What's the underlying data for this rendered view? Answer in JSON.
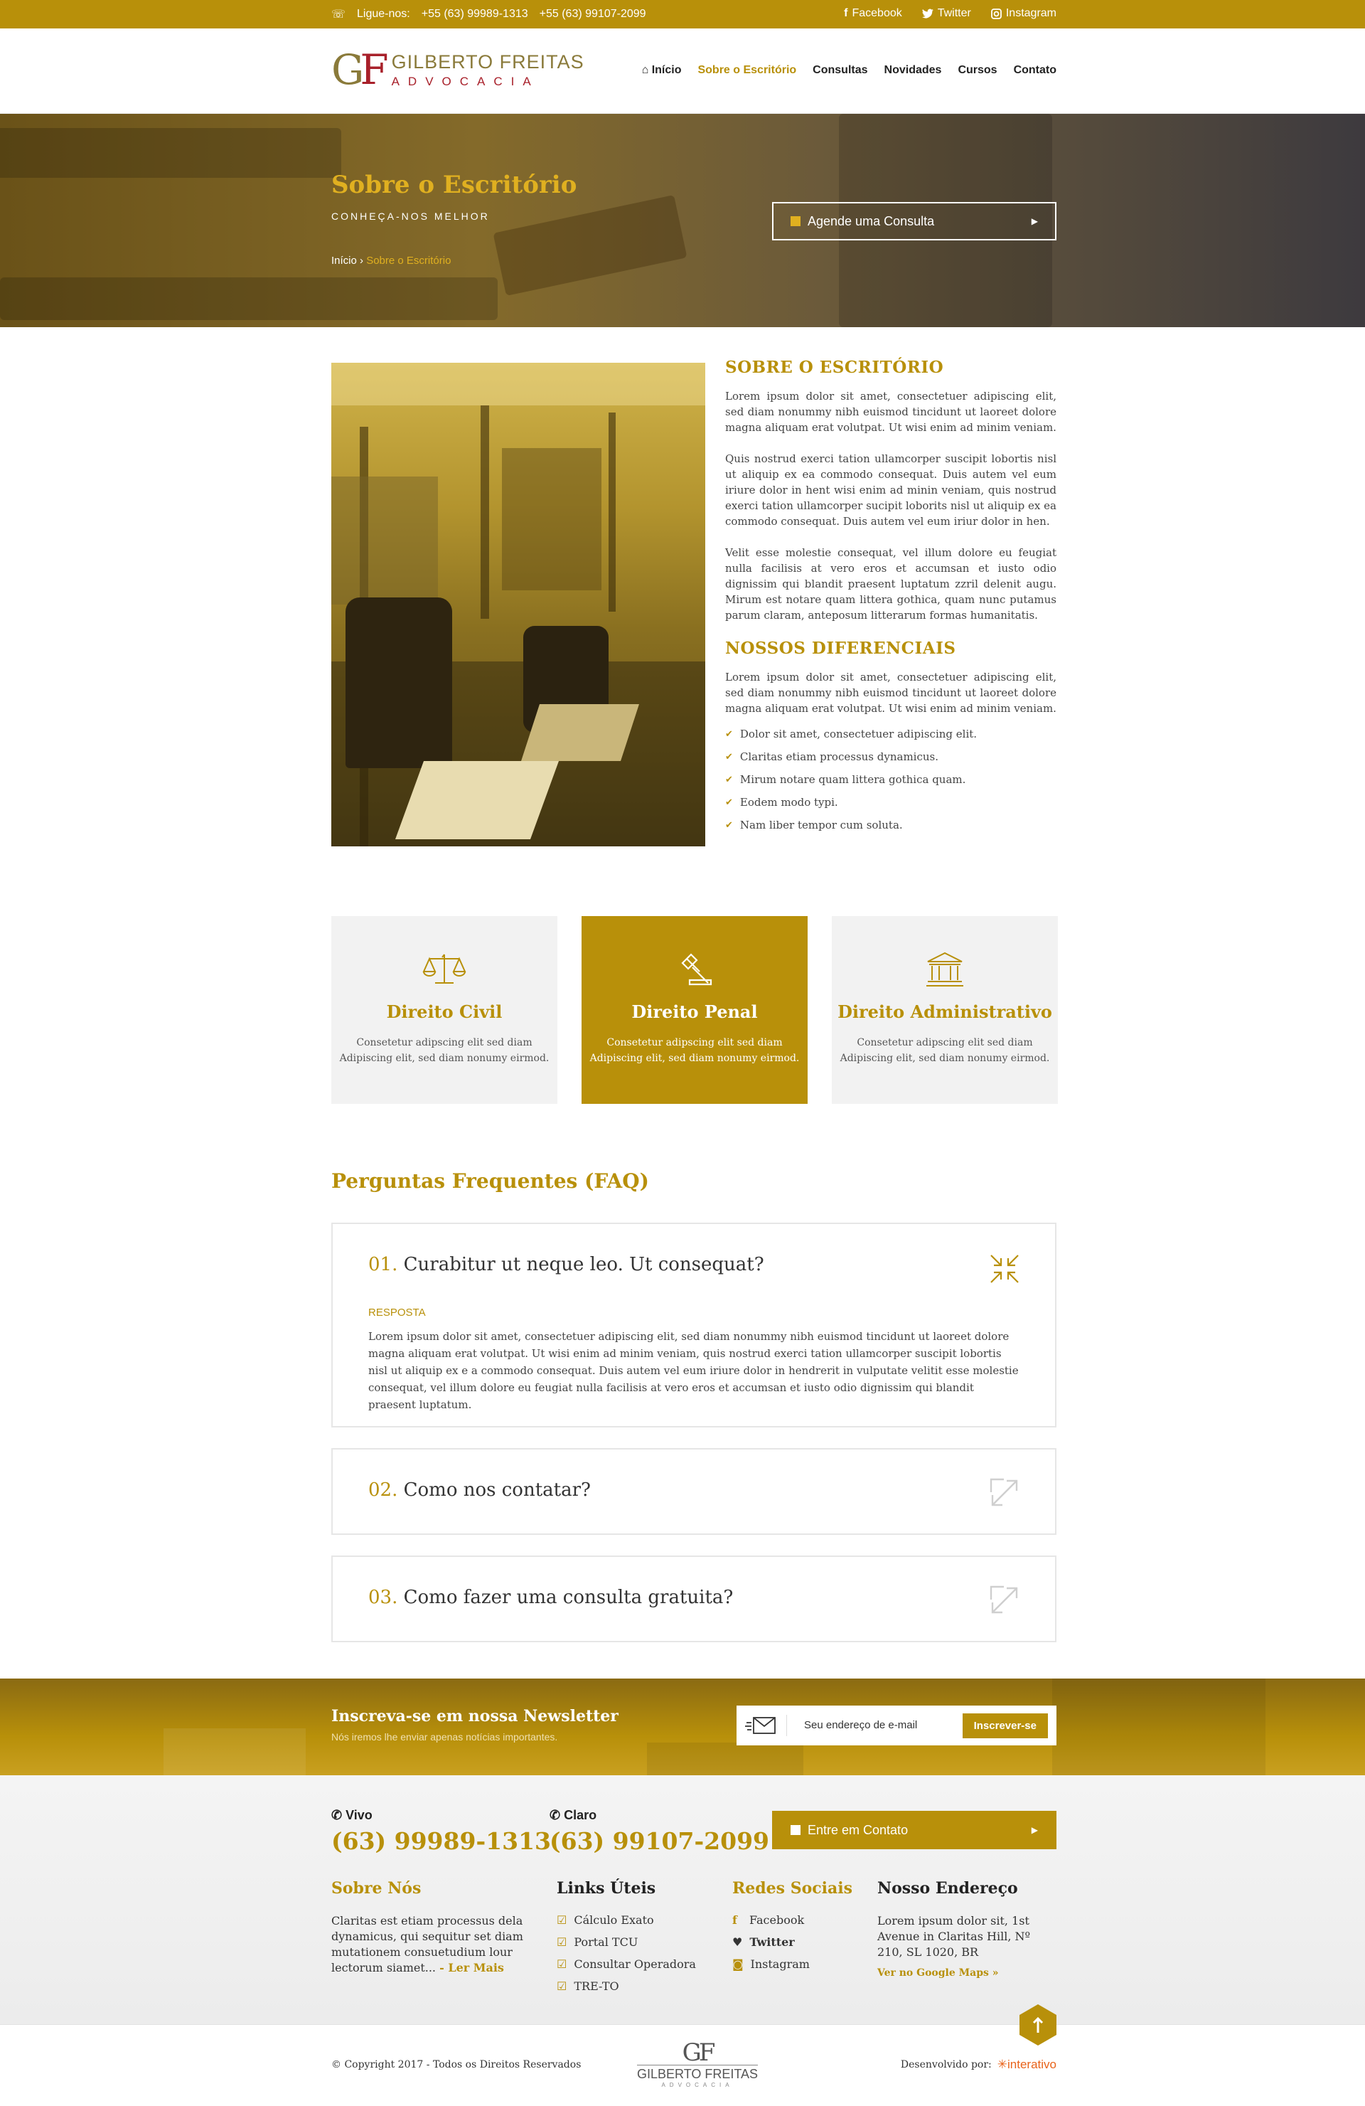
{
  "topbar": {
    "phone_label": "Ligue-nos:",
    "phone1": "+55 (63) 99989-1313",
    "phone2": "+55 (63) 99107-2099",
    "social": [
      "Facebook",
      "Twitter",
      "Instagram"
    ]
  },
  "logo": {
    "mono_g": "G",
    "mono_f": "F",
    "name": "GILBERTO FREITAS",
    "tag": "ADVOCACIA"
  },
  "nav": {
    "items": [
      "Início",
      "Sobre o Escritório",
      "Consultas",
      "Novidades",
      "Cursos",
      "Contato"
    ],
    "active": "Sobre o Escritório"
  },
  "hero": {
    "title": "Sobre o Escritório",
    "subtitle": "CONHEÇA-NOS MELHOR",
    "cta": "Agende uma Consulta",
    "breadcrumb": [
      "Início",
      "Sobre o Escritório"
    ]
  },
  "about": {
    "title": "SOBRE O ESCRITÓRIO",
    "p1": "Lorem ipsum dolor sit amet, consectetuer adipiscing elit, sed diam nonummy nibh euismod tincidunt ut laoreet dolore magna aliquam erat volutpat. Ut wisi enim ad minim veniam.",
    "p2": "Quis nostrud exerci tation ullamcorper suscipit lobortis nisl ut aliquip ex ea commodo consequat. Duis autem vel eum iriure dolor in hent wisi enim ad minin veniam, quis nostrud exerci tation ullamcorper sucipit loborits nisl ut aliquip ex ea commodo consequat. Duis autem vel eum iriur dolor in hen.",
    "p3": "Velit esse molestie consequat, vel illum dolore eu feugiat nulla facilisis at vero eros et accumsan et iusto odio dignissim qui blandit praesent luptatum zzril delenit augu. Mirum est notare quam littera gothica, quam nunc putamus parum claram, anteposum litterarum formas humanitatis.",
    "diff_title": "NOSSOS DIFERENCIAIS",
    "diff_text": "Lorem ipsum dolor sit amet, consectetuer adipiscing elit, sed diam nonummy nibh euismod tincidunt ut laoreet dolore magna aliquam erat volutpat. Ut wisi enim ad minim veniam.",
    "list": [
      "Dolor sit amet, consectetuer adipiscing elit.",
      "Claritas etiam processus dynamicus.",
      "Mirum notare quam littera gothica quam.",
      "Eodem modo typi.",
      "Nam liber tempor cum soluta."
    ]
  },
  "areas": [
    {
      "title": "Direito Civil",
      "l1": "Consetetur adipscing elit sed diam",
      "l2": "Adipiscing elit, sed diam nonumy eirmod.",
      "icon": "scales-icon"
    },
    {
      "title": "Direito Penal",
      "l1": "Consetetur adipscing elit sed diam",
      "l2": "Adipiscing elit, sed diam nonumy eirmod.",
      "icon": "gavel-icon"
    },
    {
      "title": "Direito Administrativo",
      "l1": "Consetetur adipscing elit sed diam",
      "l2": "Adipiscing elit, sed diam nonumy eirmod.",
      "icon": "courthouse-icon"
    }
  ],
  "faq": {
    "title": "Perguntas Frequentes (FAQ)",
    "items": [
      {
        "num": "01.",
        "q": "Curabitur ut neque leo. Ut consequat?",
        "label": "RESPOSTA",
        "a": "Lorem ipsum dolor sit amet, consectetuer adipiscing elit, sed diam nonummy nibh euismod tincidunt ut laoreet dolore magna aliquam erat volutpat. Ut wisi enim ad minim veniam, quis nostrud exerci tation ullamcorper suscipit lobortis nisl ut aliquip ex e a commodo consequat. Duis autem vel eum iriure dolor in hendrerit in vulputate velitit esse molestie consequat, vel illum dolore eu feugiat nulla facilisis at vero eros et accumsan et iusto odio dignissim qui blandit praesent luptatum."
      },
      {
        "num": "02.",
        "q": "Como nos contatar?"
      },
      {
        "num": "03.",
        "q": "Como fazer uma consulta gratuita?"
      }
    ]
  },
  "newsletter": {
    "title": "Inscreva-se em nossa Newsletter",
    "sub": "Nós iremos lhe enviar apenas notícias importantes.",
    "placeholder": "Seu endereço de e-mail",
    "button": "Inscrever-se"
  },
  "footer": {
    "vivo_label": "Vivo",
    "vivo": "(63) 99989-1313",
    "claro_label": "Claro",
    "claro": "(63) 99107-2099",
    "cta": "Entre em Contato",
    "about_title": "Sobre Nós",
    "about_text": "Claritas est etiam processus dela dynamicus, qui sequitur set diam mutationem consuetudium lour lectorum siamet...",
    "read_more": "- Ler Mais",
    "links_title": "Links Úteis",
    "links": [
      "Cálculo Exato",
      "Portal TCU",
      "Consultar Operadora",
      "TRE-TO"
    ],
    "social_title": "Redes Sociais",
    "social": [
      "Facebook",
      "Twitter",
      "Instagram"
    ],
    "address_title": "Nosso Endereço",
    "address": "Lorem ipsum dolor sit, 1st Avenue in Claritas Hill, Nº 210, SL 1020, BR",
    "maps": "Ver no Google Maps »",
    "copyright": "© Copyright 2017 - Todos os Direitos Reservados",
    "dev_label": "Desenvolvido por:",
    "dev_brand": "interativo",
    "logo_name": "GILBERTO FREITAS",
    "logo_tag": "ADVOCACIA"
  },
  "colors": {
    "accent": "#b8900a",
    "dark": "#222222"
  }
}
